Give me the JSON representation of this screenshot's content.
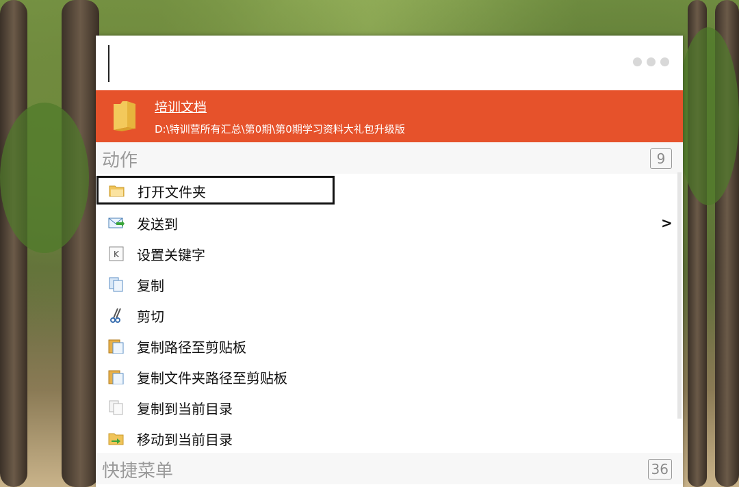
{
  "search": {
    "value": "",
    "placeholder": ""
  },
  "menu_dots": [
    "dot",
    "dot",
    "dot"
  ],
  "result": {
    "title": "培训文档",
    "path": "D:\\特训营所有汇总\\第0期\\第0期学习资料大礼包升级版",
    "icon": "folder-icon",
    "highlight_color": "#e6522b"
  },
  "actions": {
    "title": "动作",
    "count": "9",
    "items": [
      {
        "label": "打开文件夹",
        "icon": "open-folder-icon"
      },
      {
        "label": "发送到",
        "icon": "send-to-icon",
        "submenu": ">"
      },
      {
        "label": "设置关键字",
        "icon": "keyword-icon"
      },
      {
        "label": "复制",
        "icon": "copy-icon"
      },
      {
        "label": "剪切",
        "icon": "scissors-icon"
      },
      {
        "label": "复制路径至剪贴板",
        "icon": "clipboard-icon"
      },
      {
        "label": "复制文件夹路径至剪贴板",
        "icon": "clipboard-icon"
      },
      {
        "label": "复制到当前目录",
        "icon": "copy-page-icon"
      },
      {
        "label": "移动到当前目录",
        "icon": "move-folder-icon"
      }
    ]
  },
  "quick_menu": {
    "title": "快捷菜单",
    "count": "36"
  }
}
